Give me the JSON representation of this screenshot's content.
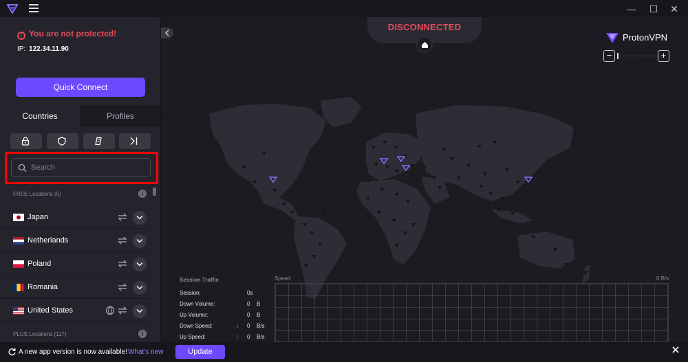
{
  "window": {
    "minimize_glyph": "—",
    "maximize_glyph": "☐",
    "close_glyph": "✕"
  },
  "sidebar": {
    "status_text": "You are not protected!",
    "ip_label": "IP:",
    "ip_value": "122.34.11.90",
    "quick_connect_label": "Quick Connect",
    "tabs": [
      {
        "label": "Countries",
        "active": true
      },
      {
        "label": "Profiles",
        "active": false
      }
    ],
    "filters": [
      {
        "icon": "lock-icon"
      },
      {
        "icon": "shield-icon"
      },
      {
        "icon": "p2p-icon"
      },
      {
        "icon": "tor-arrow-icon"
      }
    ],
    "search": {
      "placeholder": "Search",
      "value": ""
    },
    "free_section": "FREE Locations (5)",
    "plus_section": "PLUS Locations (117)",
    "info_glyph": "i",
    "countries": [
      {
        "name": "Japan",
        "flag": "jp",
        "globe": false
      },
      {
        "name": "Netherlands",
        "flag": "nl",
        "globe": false
      },
      {
        "name": "Poland",
        "flag": "pl",
        "globe": false
      },
      {
        "name": "Romania",
        "flag": "ro",
        "globe": false
      },
      {
        "name": "United States",
        "flag": "us",
        "globe": true
      }
    ]
  },
  "map": {
    "status_text": "DISCONNECTED",
    "brand_bold": "Proton",
    "brand_light": "VPN",
    "zoom_out_glyph": "−",
    "zoom_in_glyph": "+",
    "colors": {
      "accent": "#6d4aff",
      "danger": "#e94a5a",
      "land": "#2e2d35",
      "marker": "#14131a"
    }
  },
  "traffic": {
    "title": "Session Traffic",
    "speed_label": "Speed",
    "speed_value": "0 B/s",
    "rows": [
      {
        "label": "Session:",
        "value": "0s",
        "unit": "",
        "arrow": ""
      },
      {
        "label": "Down Volume:",
        "value": "0",
        "unit": "B",
        "arrow": ""
      },
      {
        "label": "Up Volume:",
        "value": "0",
        "unit": "B",
        "arrow": ""
      },
      {
        "label": "Down Speed:",
        "value": "0",
        "unit": "B/s",
        "arrow": "↓"
      },
      {
        "label": "Up Speed:",
        "value": "0",
        "unit": "B/s",
        "arrow": "↑"
      }
    ]
  },
  "bottom": {
    "message": "A new app version is now available!",
    "whats_new": "What's new",
    "update_label": "Update",
    "close_glyph": "✕"
  }
}
